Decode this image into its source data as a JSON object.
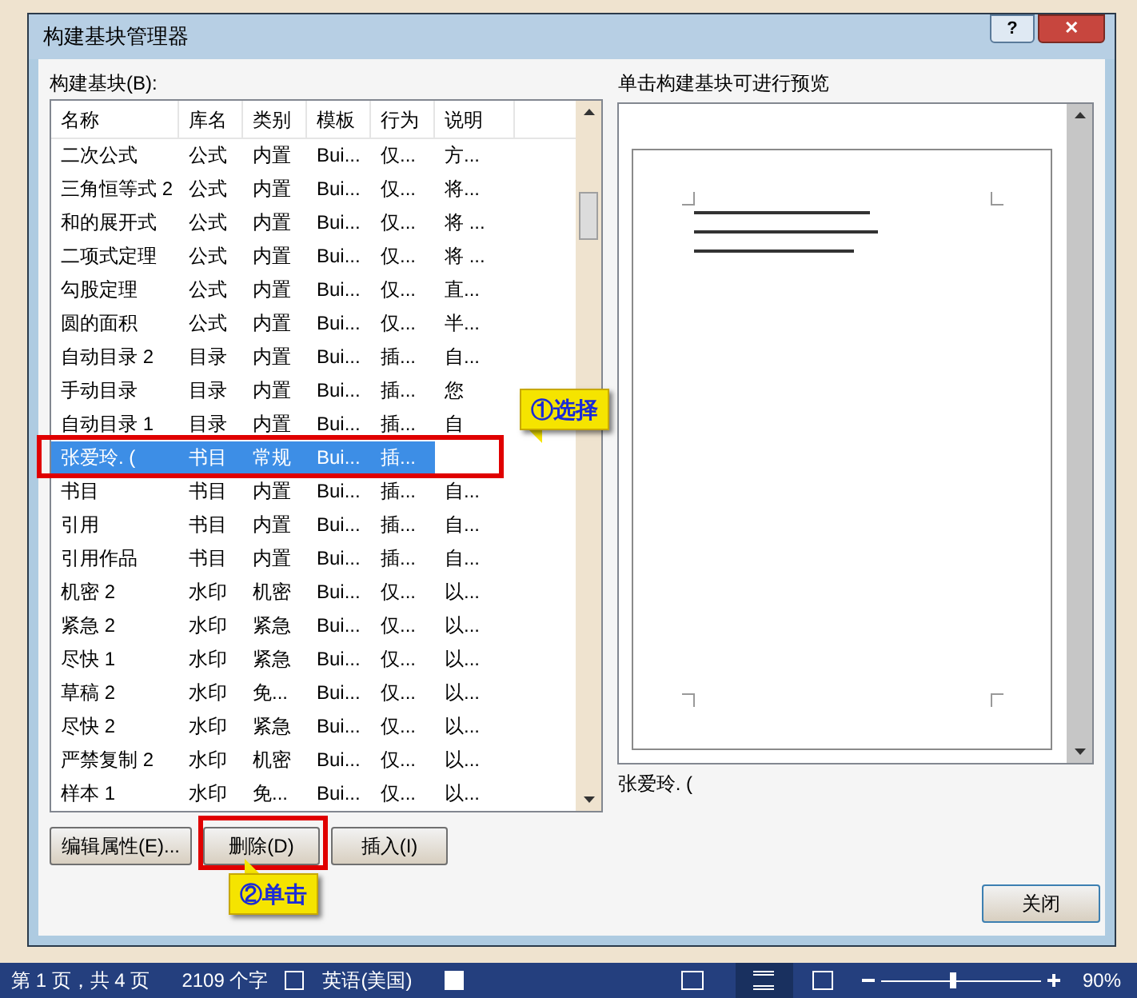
{
  "dialog": {
    "title": "构建基块管理器",
    "help_button": "?",
    "close_button": "✕"
  },
  "list": {
    "label": "构建基块(B):",
    "columns": [
      "名称",
      "库名",
      "类别",
      "模板",
      "行为",
      "说明"
    ],
    "rows": [
      {
        "cells": [
          "二次公式",
          "公式",
          "内置",
          "Bui...",
          "仅...",
          "方..."
        ],
        "selected": false
      },
      {
        "cells": [
          "三角恒等式 2",
          "公式",
          "内置",
          "Bui...",
          "仅...",
          "将..."
        ],
        "selected": false
      },
      {
        "cells": [
          "和的展开式",
          "公式",
          "内置",
          "Bui...",
          "仅...",
          "将 ..."
        ],
        "selected": false
      },
      {
        "cells": [
          "二项式定理",
          "公式",
          "内置",
          "Bui...",
          "仅...",
          "将 ..."
        ],
        "selected": false
      },
      {
        "cells": [
          "勾股定理",
          "公式",
          "内置",
          "Bui...",
          "仅...",
          "直..."
        ],
        "selected": false
      },
      {
        "cells": [
          "圆的面积",
          "公式",
          "内置",
          "Bui...",
          "仅...",
          "半..."
        ],
        "selected": false
      },
      {
        "cells": [
          "自动目录 2",
          "目录",
          "内置",
          "Bui...",
          "插...",
          "自..."
        ],
        "selected": false
      },
      {
        "cells": [
          "手动目录",
          "目录",
          "内置",
          "Bui...",
          "插...",
          "您"
        ],
        "selected": false
      },
      {
        "cells": [
          "自动目录 1",
          "目录",
          "内置",
          "Bui...",
          "插...",
          "自"
        ],
        "selected": false
      },
      {
        "cells": [
          "张爱玲. (",
          "书目",
          "常规",
          "Bui...",
          "插..."
        ],
        "selected": true
      },
      {
        "cells": [
          "书目",
          "书目",
          "内置",
          "Bui...",
          "插...",
          "自..."
        ],
        "selected": false
      },
      {
        "cells": [
          "引用",
          "书目",
          "内置",
          "Bui...",
          "插...",
          "自..."
        ],
        "selected": false
      },
      {
        "cells": [
          "引用作品",
          "书目",
          "内置",
          "Bui...",
          "插...",
          "自..."
        ],
        "selected": false
      },
      {
        "cells": [
          "机密 2",
          "水印",
          "机密",
          "Bui...",
          "仅...",
          "以..."
        ],
        "selected": false
      },
      {
        "cells": [
          "紧急 2",
          "水印",
          "紧急",
          "Bui...",
          "仅...",
          "以..."
        ],
        "selected": false
      },
      {
        "cells": [
          "尽快 1",
          "水印",
          "紧急",
          "Bui...",
          "仅...",
          "以..."
        ],
        "selected": false
      },
      {
        "cells": [
          "草稿 2",
          "水印",
          "免...",
          "Bui...",
          "仅...",
          "以..."
        ],
        "selected": false
      },
      {
        "cells": [
          "尽快 2",
          "水印",
          "紧急",
          "Bui...",
          "仅...",
          "以..."
        ],
        "selected": false
      },
      {
        "cells": [
          "严禁复制 2",
          "水印",
          "机密",
          "Bui...",
          "仅...",
          "以..."
        ],
        "selected": false
      },
      {
        "cells": [
          "样本 1",
          "水印",
          "免...",
          "Bui...",
          "仅...",
          "以..."
        ],
        "selected": false
      }
    ]
  },
  "buttons": [
    "编辑属性(E)...",
    "删除(D)",
    "插入(I)"
  ],
  "preview": {
    "label": "单击构建基块可进行预览",
    "name": "张爱玲. ("
  },
  "close_button": "关闭",
  "annotations": [
    {
      "kind": "select",
      "text": "①选择"
    },
    {
      "kind": "click",
      "text": "②单击"
    }
  ],
  "status_bar": {
    "page": "第 1 页，共 4 页",
    "words": "2109 个字",
    "language": "英语(美国)",
    "zoom": {
      "level": 0.45,
      "reading": "90%"
    }
  }
}
